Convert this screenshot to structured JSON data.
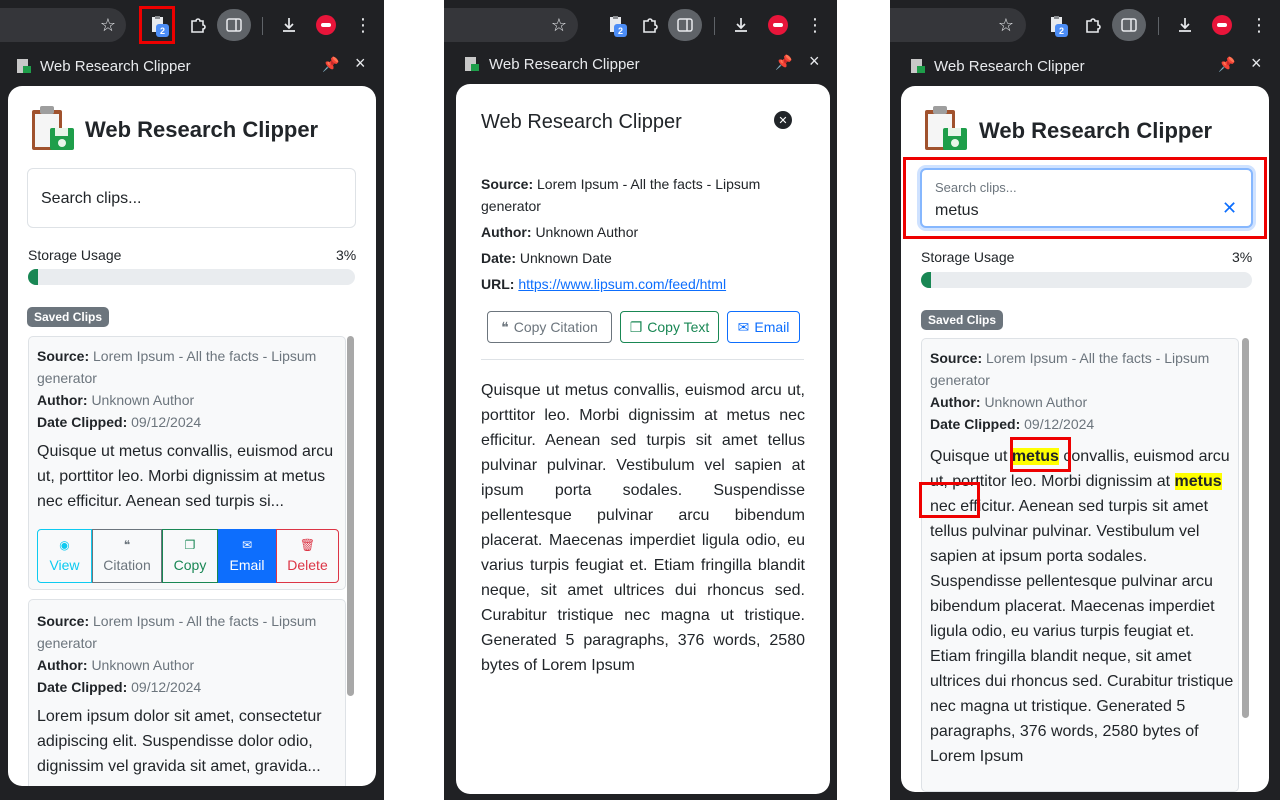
{
  "panels": {
    "left": {
      "toolbar": {
        "badge_count": "2"
      },
      "header": {
        "title": "Web Research Clipper"
      },
      "app_title": "Web Research Clipper",
      "search": {
        "placeholder": "Search clips..."
      },
      "storage": {
        "label": "Storage Usage",
        "percent_text": "3%",
        "percent": 3
      },
      "saved_clips_label": "Saved Clips",
      "clips": [
        {
          "source_label": "Source:",
          "source": "Lorem Ipsum - All the facts - Lipsum generator",
          "author_label": "Author:",
          "author": "Unknown Author",
          "date_label": "Date Clipped:",
          "date": "09/12/2024",
          "excerpt": "Quisque ut metus convallis, euismod arcu ut, porttitor leo. Morbi dignissim at metus nec efficitur. Aenean sed turpis si...",
          "actions": {
            "view": "View",
            "citation": "Citation",
            "copy": "Copy",
            "email": "Email",
            "delete": "Delete"
          }
        },
        {
          "source_label": "Source:",
          "source": "Lorem Ipsum - All the facts - Lipsum generator",
          "author_label": "Author:",
          "author": "Unknown Author",
          "date_label": "Date Clipped:",
          "date": "09/12/2024",
          "excerpt": "Lorem ipsum dolor sit amet, consectetur adipiscing elit. Suspendisse dolor odio, dignissim vel gravida sit amet, gravida..."
        }
      ]
    },
    "middle": {
      "toolbar": {
        "badge_count": "2"
      },
      "header": {
        "title": "Web Research Clipper"
      },
      "modal": {
        "title": "Web Research Clipper",
        "source_label": "Source:",
        "source": "Lorem Ipsum - All the facts - Lipsum generator",
        "author_label": "Author:",
        "author": "Unknown Author",
        "date_label": "Date:",
        "date": "Unknown Date",
        "url_label": "URL:",
        "url": "https://www.lipsum.com/feed/html",
        "buttons": {
          "copy_citation": "Copy Citation",
          "copy_text": "Copy Text",
          "email": "Email"
        },
        "body": "Quisque ut metus convallis, euismod arcu ut, porttitor leo. Morbi dignissim at metus nec efficitur. Aenean sed turpis sit amet tellus pulvinar pulvinar. Vestibulum vel sapien at ipsum porta sodales. Suspendisse pellentesque pulvinar arcu bibendum placerat. Maecenas imperdiet ligula odio, eu varius turpis feugiat et. Etiam fringilla blandit neque, sit amet ultrices dui rhoncus sed. Curabitur tristique nec magna ut tristique. Generated 5 paragraphs, 376 words, 2580 bytes of Lorem Ipsum"
      }
    },
    "right": {
      "toolbar": {
        "badge_count": "2"
      },
      "header": {
        "title": "Web Research Clipper"
      },
      "app_title": "Web Research Clipper",
      "search": {
        "label": "Search clips...",
        "value": "metus"
      },
      "storage": {
        "label": "Storage Usage",
        "percent_text": "3%",
        "percent": 3
      },
      "saved_clips_label": "Saved Clips",
      "clip": {
        "source_label": "Source:",
        "source": "Lorem Ipsum - All the facts - Lipsum generator",
        "author_label": "Author:",
        "author": "Unknown Author",
        "date_label": "Date Clipped:",
        "date": "09/12/2024",
        "text_1": "Quisque ut ",
        "highlight_1": "metus",
        "text_2": " convallis, euismod arcu ut, porttitor leo. Morbi dignissim at ",
        "highlight_2": "metus",
        "text_3": " nec efficitur. Aenean sed turpis sit amet tellus pulvinar pulvinar. Vestibulum vel sapien at ipsum porta sodales. Suspendisse pellentesque pulvinar arcu bibendum placerat. Maecenas imperdiet ligula odio, eu varius turpis feugiat et. Etiam fringilla blandit neque, sit amet ultrices dui rhoncus sed. Curabitur tristique nec magna ut tristique. Generated 5 paragraphs, 376 words, 2580 bytes of Lorem Ipsum"
      }
    }
  },
  "colors": {
    "chrome_dark": "#202124",
    "success": "#198754",
    "primary": "#0d6efd",
    "danger": "#dc3545",
    "info": "#0dcaf0",
    "secondary": "#6c757d",
    "highlight": "#ffff00",
    "annotation_red": "#ee0000"
  }
}
